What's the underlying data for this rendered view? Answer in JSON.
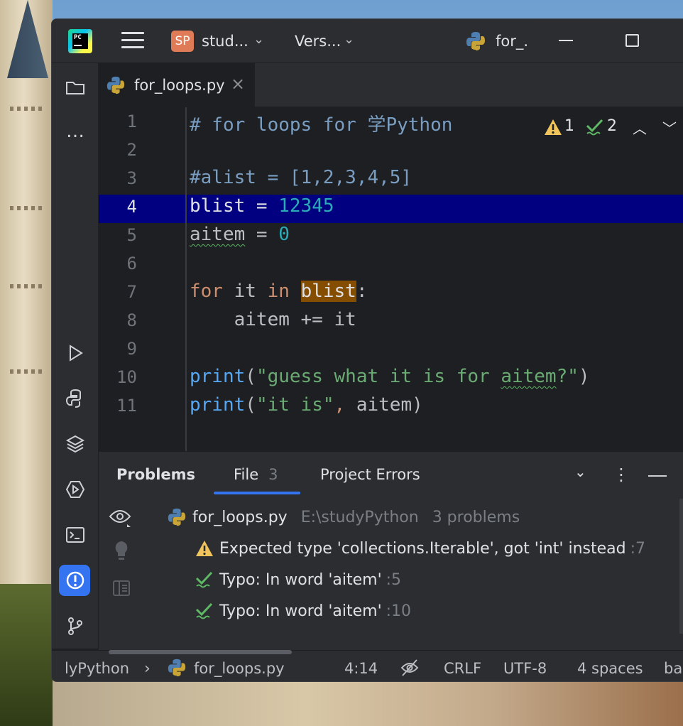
{
  "titlebar": {
    "project_badge": "SP",
    "project_name": "stud...",
    "vcs_label": "Vers...",
    "run_config": "for_."
  },
  "tab": {
    "filename": "for_loops.py",
    "close_glyph": "×"
  },
  "editor": {
    "line_numbers": [
      "1",
      "2",
      "3",
      "4",
      "5",
      "6",
      "7",
      "8",
      "9",
      "10",
      "11"
    ],
    "warnings_count": "1",
    "typos_count": "2"
  },
  "code": {
    "l1": "# for loops for 学Python",
    "l3": "#alist = [1,2,3,4,5]",
    "l4_var": "blist",
    "l4_op": " = ",
    "l4_num": "12345",
    "l5_var": "aitem",
    "l5_op": " = ",
    "l5_num": "0",
    "l7_for": "for",
    "l7_it": " it ",
    "l7_in": "in",
    "l7_sp": " ",
    "l7_var": "blist",
    "l7_colon": ":",
    "l8": "    aitem += it",
    "l10_fn": "print",
    "l10_p1": "(",
    "l10_str_a": "\"guess what it is for ",
    "l10_str_b": "aitem",
    "l10_str_c": "?\"",
    "l10_p2": ")",
    "l11_fn": "print",
    "l11_p1": "(",
    "l11_str": "\"it is\"",
    "l11_comma": ",",
    "l11_rest": " aitem)"
  },
  "problems_panel": {
    "tab_problems": "Problems",
    "tab_file": "File",
    "tab_file_count": "3",
    "tab_project_errors": "Project Errors",
    "file_name": "for_loops.py",
    "file_path": "E:\\studyPython",
    "file_problems": "3 problems",
    "items": [
      {
        "text": "Expected type 'collections.Iterable', got 'int' instead",
        "line": ":7",
        "kind": "warning"
      },
      {
        "text": "Typo: In word 'aitem'",
        "line": ":5",
        "kind": "typo"
      },
      {
        "text": "Typo: In word 'aitem'",
        "line": ":10",
        "kind": "typo"
      }
    ]
  },
  "statusbar": {
    "breadcrumb_project": "lyPython",
    "breadcrumb_sep": "›",
    "breadcrumb_file": "for_loops.py",
    "caret": "4:14",
    "line_sep": "CRLF",
    "encoding": "UTF-8",
    "indent": "4 spaces",
    "interpreter": "ba"
  },
  "colors": {
    "accent": "#3574f0",
    "warning": "#f2c55c",
    "typo": "#5fb865",
    "line_highlight": "#000080",
    "usage_highlight": "#844d00"
  }
}
